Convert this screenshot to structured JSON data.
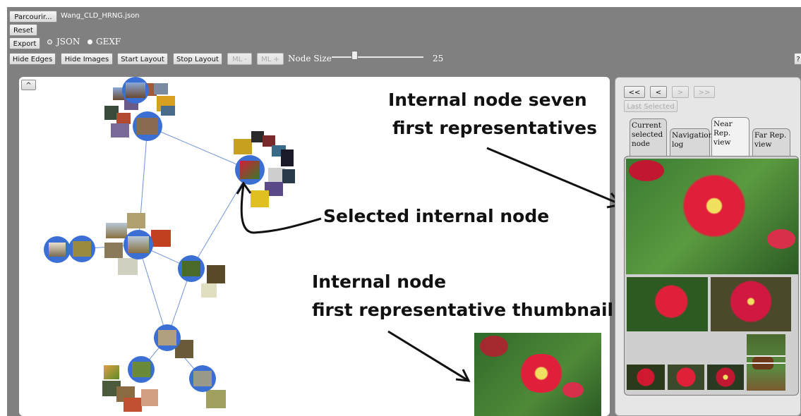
{
  "toolbar": {
    "browse_label": "Parcourir...",
    "filename": "Wang_CLD_HRNG.json",
    "reset_label": "Reset",
    "export_label": "Export",
    "format_json": "JSON",
    "format_gexf": "GEXF",
    "hide_edges_label": "Hide Edges",
    "hide_images_label": "Hide Images",
    "start_layout_label": "Start Layout",
    "stop_layout_label": "Stop Layout",
    "ml_minus_label": "ML -",
    "ml_plus_label": "ML +",
    "node_size_label": "Node Size",
    "node_size_value": "25",
    "help_label": "?"
  },
  "graph": {
    "collapse_label": "^",
    "node_color": "#3b6fd4",
    "edge_color": "#6f93d8"
  },
  "right_panel": {
    "nav_first": "<<",
    "nav_prev": "<",
    "nav_next": ">",
    "nav_last": ">>",
    "last_selected_label": "Last Selected",
    "tabs": [
      {
        "label": "Current selected node"
      },
      {
        "label": "Navigation log"
      },
      {
        "label": "Near Rep. view"
      },
      {
        "label": "Far Rep. view"
      }
    ]
  },
  "annotations": {
    "internal_seven_line1": "Internal node seven",
    "internal_seven_line2": "first representatives",
    "selected_node": "Selected internal node",
    "thumb_line1": "Internal node",
    "thumb_line2": "first representative thumbnail"
  }
}
